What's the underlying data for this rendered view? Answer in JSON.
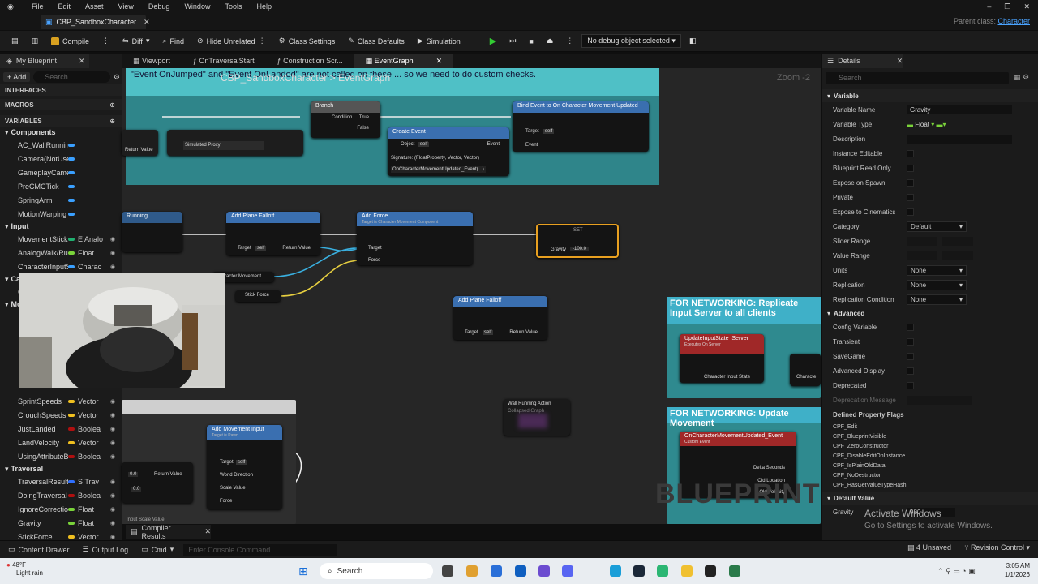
{
  "menu": [
    "File",
    "Edit",
    "Asset",
    "View",
    "Debug",
    "Window",
    "Tools",
    "Help"
  ],
  "asset_tab": "CBP_SandboxCharacter",
  "parent_class": {
    "label": "Parent class:",
    "value": "Character"
  },
  "toolbar": {
    "compile": "Compile",
    "diff": "Diff",
    "find": "Find",
    "hide_unrelated": "Hide Unrelated",
    "class_settings": "Class Settings",
    "class_defaults": "Class Defaults",
    "simulation": "Simulation",
    "debug_select": "No debug object selected"
  },
  "my_blueprint": {
    "tab": "My Blueprint",
    "add": "+ Add",
    "search_placeholder": "Search",
    "interfaces": "INTERFACES",
    "macros": "MACROS",
    "variables": "VARIABLES"
  },
  "variables": {
    "components_cat": "Components",
    "components": [
      {
        "name": "AC_WallRunning",
        "color": "#3aa0ff"
      },
      {
        "name": "Camera(NotUsedI",
        "color": "#3aa0ff"
      },
      {
        "name": "GameplayCamera",
        "color": "#3aa0ff"
      },
      {
        "name": "PreCMCTick",
        "color": "#3aa0ff"
      },
      {
        "name": "SpringArm",
        "color": "#3aa0ff"
      },
      {
        "name": "MotionWarping",
        "color": "#3aa0ff"
      }
    ],
    "input_cat": "Input",
    "input": [
      {
        "name": "MovementStick",
        "type": "E Analo",
        "color": "#20b070"
      },
      {
        "name": "AnalogWalk/Rur",
        "type": "Float",
        "color": "#7ad33a"
      },
      {
        "name": "CharacterInputS",
        "type": "Charac",
        "color": "#3aa0ff"
      }
    ],
    "camera_cat": "Camera",
    "camera": [
      {
        "name": "CameraStyle",
        "type": "E Came",
        "color": "#20b070"
      }
    ],
    "mov_cat": "Mov",
    "lower": [
      {
        "name": "SprintSpeeds",
        "type": "Vector",
        "color": "#f0c020"
      },
      {
        "name": "CrouchSpeeds",
        "type": "Vector",
        "color": "#f0c020"
      },
      {
        "name": "JustLanded",
        "type": "Boolea",
        "color": "#b01010"
      },
      {
        "name": "LandVelocity",
        "type": "Vector",
        "color": "#f0c020"
      },
      {
        "name": "UsingAttributeB",
        "type": "Boolea",
        "color": "#b01010"
      }
    ],
    "traversal_cat": "Traversal",
    "traversal": [
      {
        "name": "TraversalResult",
        "type": "S Trav",
        "color": "#3070ff"
      },
      {
        "name": "DoingTraversal",
        "type": "Boolea",
        "color": "#b01010"
      },
      {
        "name": "IgnoreCorrectio",
        "type": "Float",
        "color": "#7ad33a"
      }
    ],
    "bottom": [
      {
        "name": "Gravity",
        "type": "Float",
        "color": "#7ad33a"
      },
      {
        "name": "StickForce",
        "type": "Vector",
        "color": "#f0c020"
      }
    ]
  },
  "graph_tabs": [
    "Viewport",
    "OnTraversalStart",
    "Construction Scr...",
    "EventGraph"
  ],
  "graph": {
    "comment_text": "\"Event OnJumped\" and \"Event OnLanded\" are not called on these ... so we need to do custom checks.",
    "breadcrumb": "CBP_SandboxCharacter > EventGraph",
    "zoom": "Zoom -2",
    "nodes": {
      "branch": {
        "title": "Branch",
        "pins": [
          "True",
          "Condition",
          "False"
        ]
      },
      "simulated_proxy": "Simulated Proxy",
      "bind_event": {
        "title": "Bind Event to On Character Movement Updated",
        "pins": [
          "Target",
          "self",
          "Event"
        ]
      },
      "create_event": {
        "title": "Create Event",
        "pins": [
          "Object",
          "self",
          "Event"
        ],
        "signature": "Signature: (FloatProperty, Vector, Vector)",
        "function": "OnCharacterMovementUpdated_Event(...)"
      },
      "return_value": "Return Value",
      "is_wall_running": "Running",
      "add_plane_falloff_1": {
        "title": "Add Plane Falloff",
        "pins": [
          "Target",
          "self",
          "Return Value"
        ]
      },
      "add_force": {
        "title": "Add Force",
        "subtitle": "Target is Character Movement Component",
        "pins": [
          "Target",
          "Force"
        ]
      },
      "set_gravity": {
        "title": "SET",
        "pin": "Gravity",
        "value": "-100.0"
      },
      "char_movement": "Character Movement",
      "stick_force": "Stick Force",
      "add_plane_falloff_2": {
        "title": "Add Plane Falloff",
        "pins": [
          "Target",
          "self",
          "Return Value"
        ]
      },
      "net_comment_1": "FOR NETWORKING: Replicate Input Server to all clients",
      "update_input_state": {
        "title": "UpdateInputState_Server",
        "subtitle": "Executes On Server",
        "sub2": "Custom Event",
        "pin": "Character Input State"
      },
      "character_pin": "Characte",
      "wall_running_action": {
        "title": "Wall Running Action",
        "subtitle": "Collapsed Graph"
      },
      "net_comment_2": "FOR NETWORKING: Update Movement",
      "on_char_move_updated": {
        "title": "OnCharacterMovementUpdated_Event",
        "subtitle": "Custom Event",
        "pins": [
          "Delta Seconds",
          "Old Location",
          "Old Velocity"
        ]
      },
      "add_movement_input": {
        "title": "Add Movement Input",
        "subtitle": "Target is Pawn",
        "pins": [
          "Target",
          "self",
          "World Direction",
          "Scale Value",
          "Force"
        ]
      },
      "return_value_2": "Return Value",
      "val_a": "0.0",
      "val_b": "0.0",
      "input_scale_value": "Input Scale Value"
    },
    "watermark": "BLUEPRINT"
  },
  "compiler_results": "Compiler Results",
  "details": {
    "tab": "Details",
    "search_placeholder": "Search",
    "variable_section": "Variable",
    "rows": [
      {
        "label": "Variable Name",
        "value": "Gravity",
        "kind": "text"
      },
      {
        "label": "Variable Type",
        "value": "Float",
        "kind": "type"
      },
      {
        "label": "Description",
        "value": "",
        "kind": "text"
      },
      {
        "label": "Instance Editable",
        "kind": "check"
      },
      {
        "label": "Blueprint Read Only",
        "kind": "check"
      },
      {
        "label": "Expose on Spawn",
        "kind": "check"
      },
      {
        "label": "Private",
        "kind": "check"
      },
      {
        "label": "Expose to Cinematics",
        "kind": "check"
      },
      {
        "label": "Category",
        "value": "Default",
        "kind": "dd"
      },
      {
        "label": "Slider Range",
        "kind": "range"
      },
      {
        "label": "Value Range",
        "kind": "range"
      },
      {
        "label": "Units",
        "value": "None",
        "kind": "dd"
      },
      {
        "label": "Replication",
        "value": "None",
        "kind": "dd"
      },
      {
        "label": "Replication Condition",
        "value": "None",
        "kind": "dd"
      }
    ],
    "advanced": "Advanced",
    "adv_rows": [
      "Config Variable",
      "Transient",
      "SaveGame",
      "Advanced Display",
      "Deprecated"
    ],
    "deprecation_message": "Deprecation Message",
    "flags_title": "Defined Property Flags",
    "flags": [
      "CPF_Edit",
      "CPF_BlueprintVisible",
      "CPF_ZeroConstructor",
      "CPF_DisableEditOnInstance",
      "CPF_IsPlainOldData",
      "CPF_NoDestructor",
      "CPF_HasGetValueTypeHash"
    ],
    "default_value": "Default Value",
    "gravity_label": "Gravity",
    "gravity_value": "980"
  },
  "activate": {
    "title": "Activate Windows",
    "sub": "Go to Settings to activate Windows."
  },
  "bottom": {
    "content_drawer": "Content Drawer",
    "output_log": "Output Log",
    "cmd": "Cmd",
    "console_placeholder": "Enter Console Command",
    "unsaved": "4 Unsaved",
    "revision": "Revision Control"
  },
  "taskbar": {
    "temp": "48°F",
    "weather": "Light rain",
    "search": "Search",
    "time": "3:05 AM",
    "date": "1/1/2026"
  }
}
